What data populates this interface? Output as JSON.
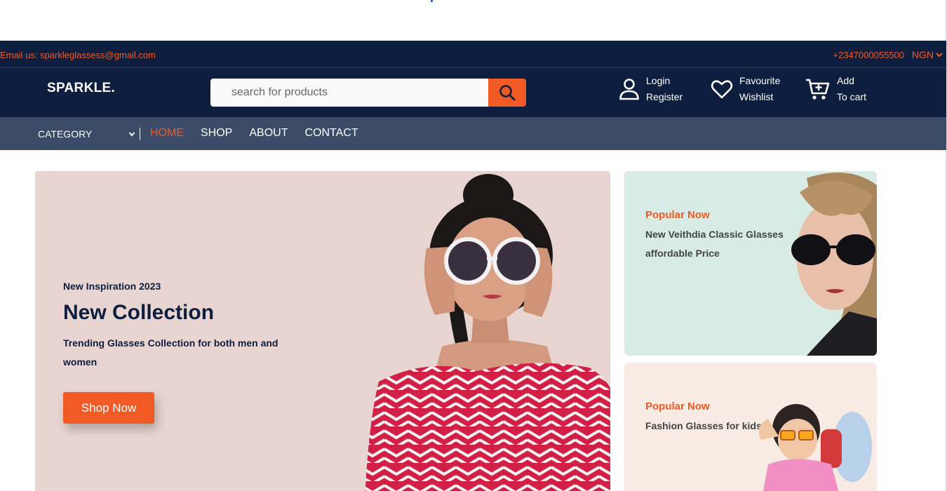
{
  "topbar": {
    "email": "Email us: sparkleglassess@gmail.com",
    "phone": "+2347000055500",
    "currency": "NGN"
  },
  "header": {
    "logo": "SPARKLE.",
    "search_placeholder": "search for products",
    "login_label": "Login",
    "register_label": "Register",
    "favourite_label": "Favourite",
    "wishlist_label": "Wishlist",
    "add_label": "Add",
    "tocart_label": "To cart"
  },
  "nav": {
    "category": "CATEGORY",
    "links": [
      "HOME",
      "SHOP",
      "ABOUT",
      "CONTACT"
    ],
    "active": "HOME"
  },
  "hero": {
    "tag": "New Inspiration 2023",
    "title": "New Collection",
    "description": "Trending Glasses Collection for both men and women",
    "button": "Shop Now"
  },
  "promos": [
    {
      "tag": "Popular Now",
      "text_line1": "New Veithdia Classic Glasses",
      "text_line2": "affordable Price"
    },
    {
      "tag": "Popular Now",
      "text_line1": "Fashion Glasses for kids"
    }
  ],
  "colors": {
    "navy": "#0d1e3f",
    "nav_bg": "#3b4b68",
    "accent": "#f15a24",
    "hero_bg": "#e8d5d2",
    "promo1_bg": "#d8ebe4",
    "promo2_bg": "#f8ebe3"
  },
  "icons": [
    "search-icon",
    "user-icon",
    "heart-icon",
    "cart-icon",
    "chevron-down-icon"
  ]
}
